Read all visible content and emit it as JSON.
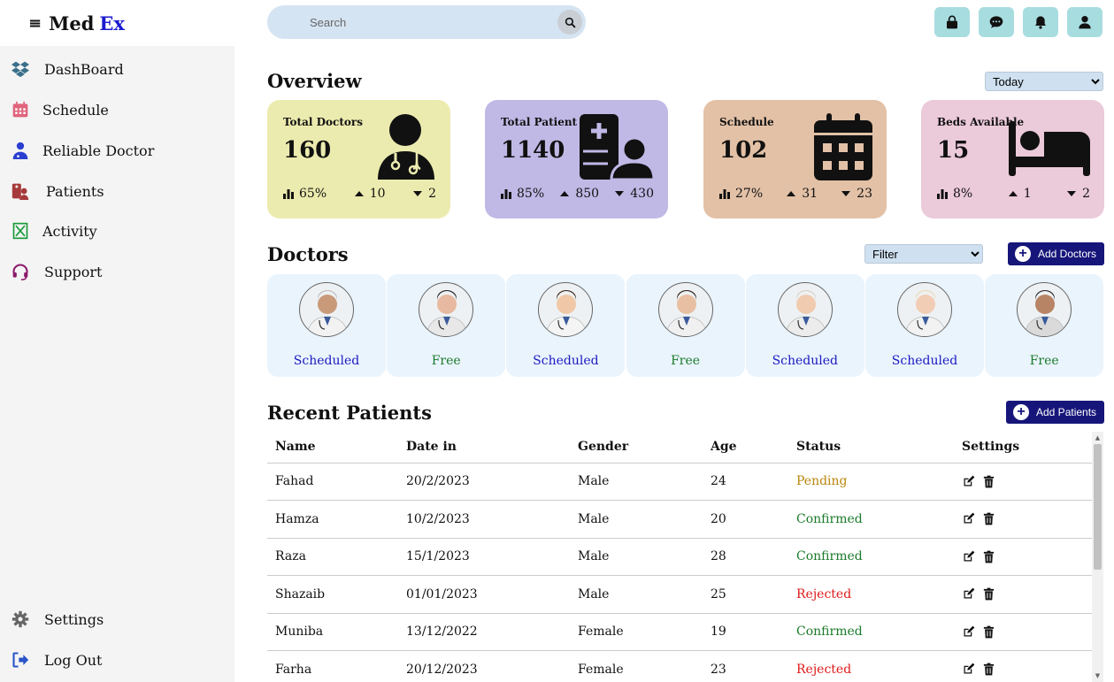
{
  "brand": {
    "menu_icon": "≡",
    "name_a": "Med",
    "name_b": "Ex"
  },
  "search": {
    "placeholder": "Search"
  },
  "sidebar": {
    "items": [
      {
        "label": "DashBoard",
        "icon": "dropbox-icon",
        "color": "#3a6f8a"
      },
      {
        "label": "Schedule",
        "icon": "calendar-icon",
        "color": "#e0647c"
      },
      {
        "label": "Reliable Doctor",
        "icon": "user-doctor-icon",
        "color": "#2a3fcf"
      },
      {
        "label": "Patients",
        "icon": "patients-icon",
        "color": "#a63a3a"
      },
      {
        "label": "Activity",
        "icon": "hourglass-icon",
        "color": "#1a9a3a"
      },
      {
        "label": "Support",
        "icon": "headset-icon",
        "color": "#8a1a6a"
      }
    ],
    "bottom": [
      {
        "label": "Settings",
        "icon": "gear-icon",
        "color": "#666666"
      },
      {
        "label": "Log Out",
        "icon": "logout-icon",
        "color": "#2a54c8"
      }
    ]
  },
  "overview": {
    "title": "Overview",
    "period_options": [
      "Today"
    ],
    "period_selected": "Today",
    "cards": [
      {
        "label": "Total Doctors",
        "value": "160",
        "pct": "65%",
        "up": "10",
        "down": "2",
        "bg": "#ecebaf",
        "icon": "doctor-icon"
      },
      {
        "label": "Total Patient",
        "value": "1140",
        "pct": "85%",
        "up": "850",
        "down": "430",
        "bg": "#c0b9e6",
        "icon": "hospital-user-icon"
      },
      {
        "label": "Schedule",
        "value": "102",
        "pct": "27%",
        "up": "31",
        "down": "23",
        "bg": "#e3c1a6",
        "icon": "calendar-days-icon"
      },
      {
        "label": "Beds Available",
        "value": "15",
        "pct": "8%",
        "up": "1",
        "down": "2",
        "bg": "#ebcad9",
        "icon": "bed-icon"
      }
    ]
  },
  "doctors": {
    "title": "Doctors",
    "filter_selected": "Filter",
    "add_label": "Add Doctors",
    "list": [
      {
        "status": "Scheduled",
        "color": "#1a1ac0"
      },
      {
        "status": "Free",
        "color": "#1a7a2a"
      },
      {
        "status": "Scheduled",
        "color": "#1a1ac0"
      },
      {
        "status": "Free",
        "color": "#1a7a2a"
      },
      {
        "status": "Scheduled",
        "color": "#1a1ac0"
      },
      {
        "status": "Scheduled",
        "color": "#1a1ac0"
      },
      {
        "status": "Free",
        "color": "#1a7a2a"
      }
    ]
  },
  "patients": {
    "title": "Recent Patients",
    "add_label": "Add Patients",
    "columns": [
      "Name",
      "Date in",
      "Gender",
      "Age",
      "Status",
      "Settings"
    ],
    "rows": [
      {
        "name": "Fahad",
        "date": "20/2/2023",
        "gender": "Male",
        "age": "24",
        "status": "Pending",
        "color": "#b8860b"
      },
      {
        "name": "Hamza",
        "date": "10/2/2023",
        "gender": "Male",
        "age": "20",
        "status": "Confirmed",
        "color": "#1a7a2a"
      },
      {
        "name": "Raza",
        "date": "15/1/2023",
        "gender": "Male",
        "age": "28",
        "status": "Confirmed",
        "color": "#1a7a2a"
      },
      {
        "name": "Shazaib",
        "date": "01/01/2023",
        "gender": "Male",
        "age": "25",
        "status": "Rejected",
        "color": "#e01a1a"
      },
      {
        "name": "Muniba",
        "date": "13/12/2022",
        "gender": "Female",
        "age": "19",
        "status": "Confirmed",
        "color": "#1a7a2a"
      },
      {
        "name": "Farha",
        "date": "20/12/2023",
        "gender": "Female",
        "age": "23",
        "status": "Rejected",
        "color": "#e01a1a"
      }
    ]
  },
  "topbar": {
    "icons": [
      "lock-icon",
      "message-icon",
      "bell-icon",
      "user-icon"
    ]
  }
}
